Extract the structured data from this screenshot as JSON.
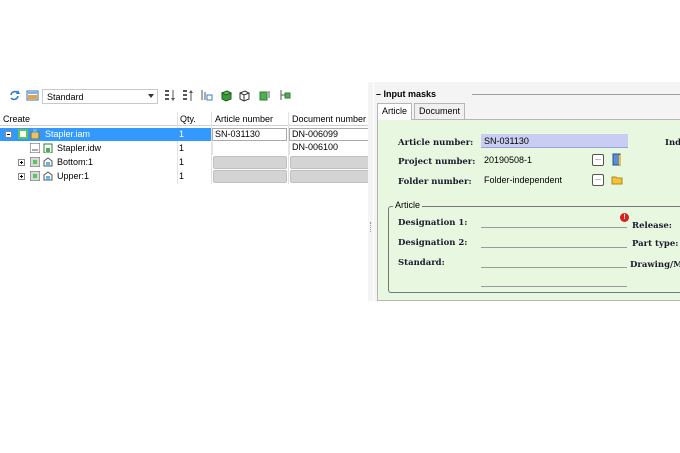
{
  "toolbar": {
    "combo_value": "Standard",
    "icons": [
      "sync-icon",
      "view-icon",
      "sort-desc-icon",
      "sort-asc-icon",
      "filter-icon",
      "cube-icon",
      "cube-outline-icon",
      "export-icon",
      "tree-icon"
    ]
  },
  "grid": {
    "headers": {
      "create": "Create",
      "qty": "Qty.",
      "article": "Article number",
      "document": "Document number"
    },
    "rows": [
      {
        "name": "Stapler.iam",
        "qty": "1",
        "article": "SN-031130",
        "document": "DN-006099",
        "selected": true
      },
      {
        "name": "Stapler.idw",
        "qty": "1",
        "article": "",
        "document": "DN-006100",
        "selected": false
      },
      {
        "name": "Bottom:1",
        "qty": "1",
        "article": "",
        "document": "",
        "selected": false
      },
      {
        "name": "Upper:1",
        "qty": "1",
        "article": "",
        "document": "",
        "selected": false
      }
    ]
  },
  "input_masks": {
    "title": "Input masks",
    "tabs": [
      "Article",
      "Document"
    ],
    "labels": {
      "article_number": "Article number:",
      "project_number": "Project number:",
      "folder_number": "Folder number:",
      "designation1": "Designation 1:",
      "designation2": "Designation 2:",
      "standard": "Standard:",
      "release": "Release:",
      "part_type": "Part type:",
      "drawing": "Drawing/M",
      "ind": "Ind"
    },
    "values": {
      "article_number": "SN-031130",
      "project_number": "20190508-1",
      "folder_number": "Folder-independent",
      "designation1": "",
      "designation2": "",
      "standard": ""
    },
    "group_title": "Article",
    "browse_label": "..."
  },
  "colors": {
    "selection": "#3399ff",
    "mask_bg": "#e8f7df",
    "highlight_field": "#c9cdf2",
    "error": "#d81e1e"
  }
}
